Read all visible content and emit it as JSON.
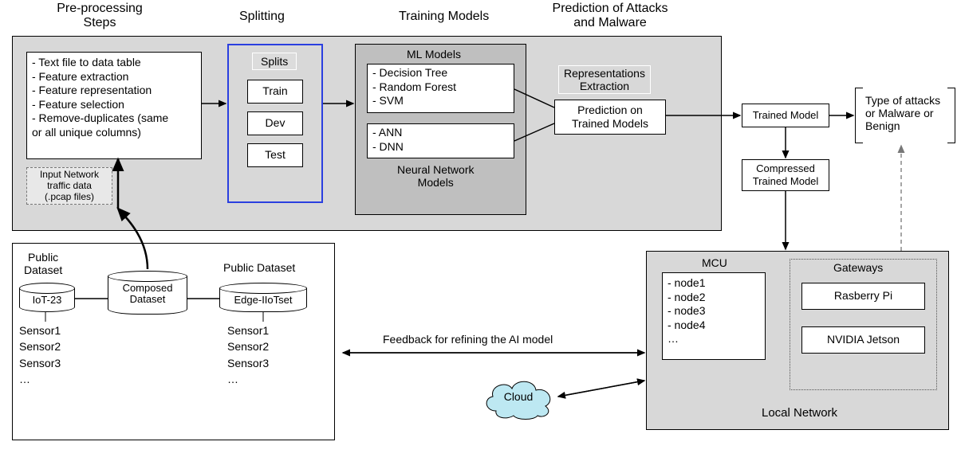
{
  "stages": {
    "preprocessing": "Pre-processing\nSteps",
    "splitting": "Splitting",
    "training": "Training Models",
    "prediction": "Prediction of Attacks\nand Malware"
  },
  "preprocessing_box": "- Text file to data table\n- Feature extraction\n- Feature representation\n- Feature selection\n- Remove-duplicates (same\n  or all unique columns)",
  "input_note": "Input Network\ntraffic data\n(.pcap files)",
  "splits": {
    "title": "Splits",
    "train": "Train",
    "dev": "Dev",
    "test": "Test"
  },
  "models": {
    "ml_title": "ML Models",
    "ml_list": "- Decision Tree\n- Random Forest\n- SVM",
    "nn_list": "- ANN\n- DNN",
    "nn_title": "Neural Network\nModels"
  },
  "rep_extraction_title": "Representations\nExtraction",
  "prediction_box": "Prediction on\nTrained Models",
  "trained_model": "Trained Model",
  "compressed_model": "Compressed\nTrained Model",
  "output_text": "Type of attacks\nor Malware or\nBenign",
  "datasets": {
    "public_left": "Public\nDataset",
    "iot23": "IoT-23",
    "composed": "Composed\nDataset",
    "public_right": "Public Dataset",
    "edge": "Edge-IIoTset",
    "sensors": "Sensor1\nSensor2\nSensor3\n…"
  },
  "feedback_text": "Feedback for refining the AI model",
  "cloud": "Cloud",
  "local_network": {
    "mcu_title": "MCU",
    "mcu_list": "- node1\n- node2\n- node3\n- node4\n…",
    "gw_title": "Gateways",
    "rpi": "Rasberry Pi",
    "jetson": "NVIDIA Jetson",
    "title": "Local Network"
  }
}
